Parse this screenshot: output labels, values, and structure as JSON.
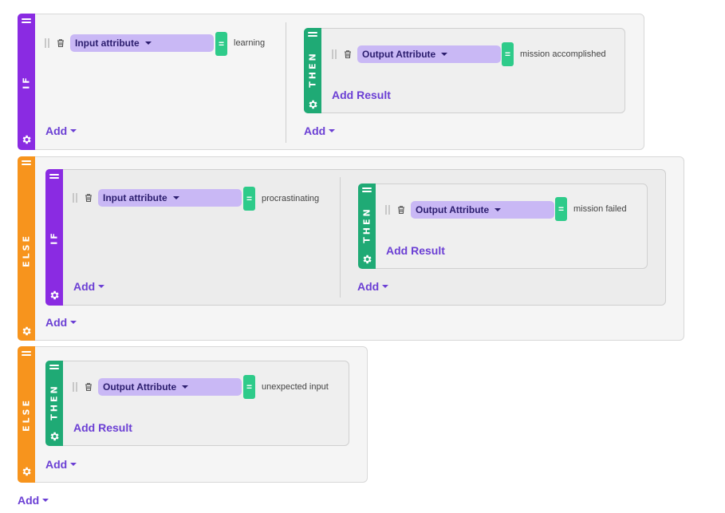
{
  "colors": {
    "if": "#8a2be2",
    "else": "#f7941d",
    "then": "#1faa75",
    "select": "#c9b8f5",
    "equals": "#2ecb8a",
    "link": "#6b3fd4"
  },
  "icons": {
    "handle": "drag-handle-icon",
    "gear": "gear-icon",
    "trash": "trash-icon",
    "grip": "grip-icon",
    "caret": "caret-down-icon"
  },
  "block1": {
    "if": {
      "label": "IF",
      "condition": {
        "attribute": "Input attribute",
        "operator": "=",
        "value": "learning"
      },
      "add_label": "Add"
    },
    "then": {
      "label": "THEN",
      "result": {
        "attribute": "Output Attribute",
        "operator": "=",
        "value": "mission accomplished"
      },
      "add_result_label": "Add Result",
      "add_label": "Add"
    }
  },
  "block2": {
    "else_label": "ELSE",
    "if": {
      "label": "IF",
      "condition": {
        "attribute": "Input attribute",
        "operator": "=",
        "value": "procrastinating"
      },
      "add_label": "Add"
    },
    "then": {
      "label": "THEN",
      "result": {
        "attribute": "Output Attribute",
        "operator": "=",
        "value": "mission failed"
      },
      "add_result_label": "Add Result",
      "add_label": "Add"
    },
    "add_label": "Add"
  },
  "block3": {
    "else_label": "ELSE",
    "then": {
      "label": "THEN",
      "result": {
        "attribute": "Output Attribute",
        "operator": "=",
        "value": "unexpected input"
      },
      "add_result_label": "Add Result"
    },
    "add_label": "Add"
  },
  "root_add_label": "Add"
}
